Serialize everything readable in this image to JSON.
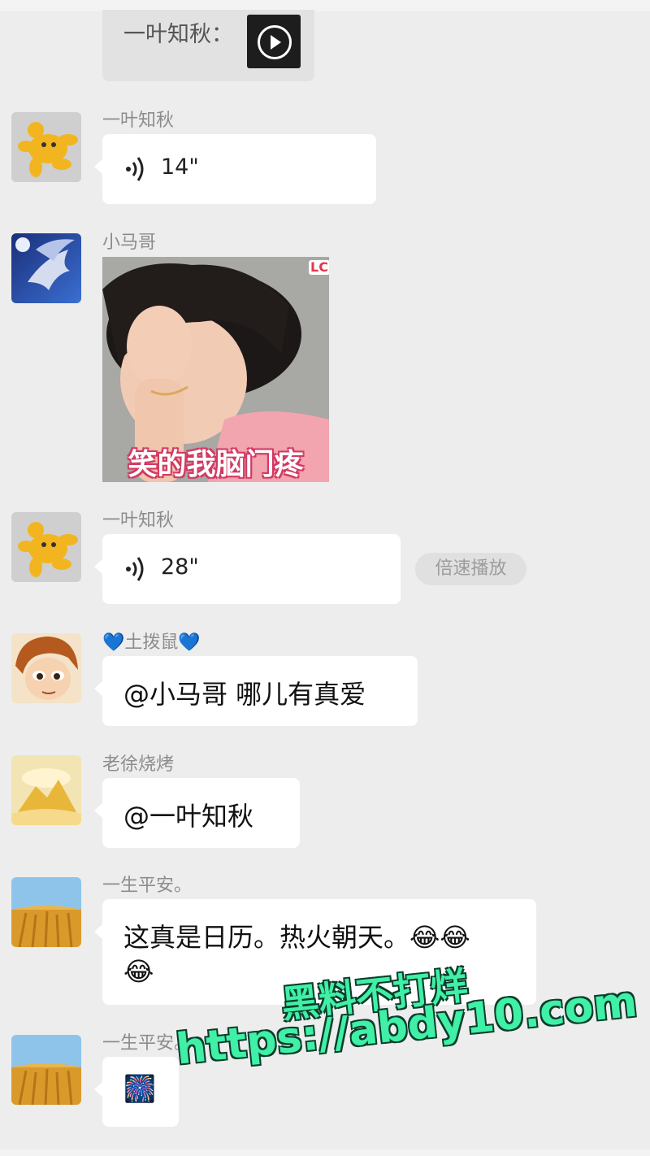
{
  "quoted": {
    "text": "一叶知秋：",
    "media": "video-thumbnail"
  },
  "messages": [
    {
      "sender": "一叶知秋",
      "type": "voice",
      "duration": "14\""
    },
    {
      "sender": "小马哥",
      "type": "image",
      "caption": "笑的我脑门疼",
      "badge": "LC"
    },
    {
      "sender": "一叶知秋",
      "type": "voice",
      "duration": "28\"",
      "action": "倍速播放"
    },
    {
      "sender_prefix": "💙",
      "sender": "土拨鼠",
      "sender_suffix": "💙",
      "type": "text",
      "text": "@小马哥 哪儿有真爱"
    },
    {
      "sender": "老徐烧烤",
      "type": "text",
      "text": "@一叶知秋"
    },
    {
      "sender": "一生平安。",
      "type": "text",
      "text": "这真是日历。热火朝天。",
      "emojis": [
        "😂",
        "😂",
        "😂"
      ]
    },
    {
      "sender": "一生平安。",
      "type": "sticker",
      "sticker": "🎆"
    }
  ],
  "watermark": {
    "line1": "黑料不打烊",
    "line2": "https://abdy10.com"
  },
  "colors": {
    "background": "#ededed",
    "bubble": "#ffffff",
    "watermark": "#3ff0a6"
  }
}
